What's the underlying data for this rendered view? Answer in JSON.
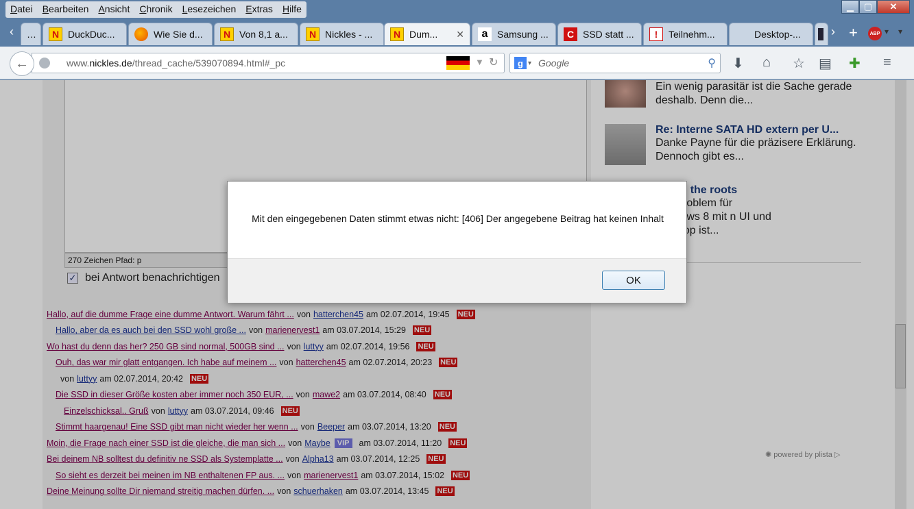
{
  "menu": [
    "Datei",
    "Bearbeiten",
    "Ansicht",
    "Chronik",
    "Lesezeichen",
    "Extras",
    "Hilfe"
  ],
  "window_controls": {
    "minimize": "▁",
    "maximize": "▢",
    "close": "✕"
  },
  "tabs": [
    {
      "label": "DuckDuc...",
      "icon": "N"
    },
    {
      "label": "Wie Sie d...",
      "icon": ""
    },
    {
      "label": "Von 8,1 a...",
      "icon": "N"
    },
    {
      "label": "Nickles - ...",
      "icon": "N"
    },
    {
      "label": "Dum...",
      "icon": "N",
      "close": "✕"
    },
    {
      "label": "Samsung ...",
      "icon": "a"
    },
    {
      "label": "SSD statt ...",
      "icon": "C"
    },
    {
      "label": "Teilnehm...",
      "icon": "!"
    },
    {
      "label": "Desktop-...",
      "icon": ""
    }
  ],
  "tabbar_controls": {
    "left": "‹",
    "right": "›",
    "new": "+",
    "abp": "ABP"
  },
  "url": {
    "prefix": "www.",
    "domain": "nickles.de",
    "path": "/thread_cache/539070894.html#_pc"
  },
  "search": {
    "placeholder": "Google",
    "engine_icon": "g"
  },
  "nav_icons": [
    "download-icon",
    "home-icon",
    "star-icon",
    "reading-list-icon",
    "puzzle-icon",
    "menu-icon"
  ],
  "editor": {
    "charinfo": "270 Zeichen Pfad: p",
    "notify_label": "bei Antwort benachrichtigen",
    "check": "✓"
  },
  "threads": [
    {
      "title": "Hallo, auf die dumme Frage eine dumme Antwort. Warum fährt ...",
      "by": "von",
      "user": "hatterchen45",
      "date": "am 02.07.2014, 19:45",
      "badge": "NEU",
      "indent": 0
    },
    {
      "title": "Hallo, aber da es auch bei den SSD wohl große ...",
      "by": "von",
      "user": "marienervest1",
      "date": "am 03.07.2014, 15:29",
      "badge": "NEU",
      "indent": 1,
      "current": true
    },
    {
      "title": "Wo hast du denn das her? 250 GB sind normal, 500GB sind ...",
      "by": "von",
      "user": "luttyy",
      "date": "am 02.07.2014, 19:56",
      "badge": "NEU",
      "indent": 0
    },
    {
      "title": "Ouh, das war mir glatt entgangen. Ich habe auf meinem ...",
      "by": "von",
      "user": "hatterchen45",
      "date": "am 02.07.2014, 20:23",
      "badge": "NEU",
      "indent": 1
    },
    {
      "title": "",
      "by": "von",
      "user": "luttyy",
      "date": "am 02.07.2014, 20:42",
      "badge": "NEU",
      "indent": 2
    },
    {
      "title": "Die SSD in dieser Größe kosten aber immer noch 350 EUR, ...",
      "by": "von",
      "user": "mawe2",
      "date": "am 03.07.2014, 08:40",
      "badge": "NEU",
      "indent": 1
    },
    {
      "title": "Einzelschicksal.. Gruß",
      "by": "von",
      "user": "luttyy",
      "date": "am 03.07.2014, 09:46",
      "badge": "NEU",
      "indent": 2
    },
    {
      "title": "Stimmt haargenau! Eine SSD gibt man nicht wieder her wenn ...",
      "by": "von",
      "user": "Beeper",
      "date": "am 03.07.2014, 13:20",
      "badge": "NEU",
      "indent": 1
    },
    {
      "title": "Moin, die Frage nach einer SSD ist die gleiche, die man sich ...",
      "by": "von",
      "user": "Maybe",
      "vip": "VIP",
      "date": "am 03.07.2014, 11:20",
      "badge": "NEU",
      "indent": 0
    },
    {
      "title": "Bei deinem NB solltest du definitiv ne SSD als Systemplatte ...",
      "by": "von",
      "user": "Alpha13",
      "date": "am 03.07.2014, 12:25",
      "badge": "NEU",
      "indent": 0
    },
    {
      "title": "So sieht es derzeit bei meinen im NB enthaltenen FP aus. ...",
      "by": "von",
      "user": "marienervest1",
      "date": "am 03.07.2014, 15:02",
      "badge": "NEU",
      "indent": 1
    },
    {
      "title": "Deine Meinung sollte Dir niemand streitig machen dürfen. ...",
      "by": "von",
      "user": "schuerhaken",
      "date": "am 03.07.2014, 13:45",
      "badge": "NEU",
      "indent": 0
    }
  ],
  "sidebar": [
    {
      "title": "",
      "text": "Ein wenig parasitär ist die Sache gerade deshalb. Denn die..."
    },
    {
      "title": "Re: Interne SATA HD extern per U...",
      "text": "Danke Payne für die präzisere Erklärung. Dennoch gibt es..."
    },
    {
      "title": "ack to the roots",
      "text": "auptproblem für Windows 8 mit n UI und Desktop ist..."
    }
  ],
  "plista": "powered by plista",
  "dialog": {
    "message": "Mit den eingegebenen Daten stimmt etwas nicht: [406] Der angegebene Beitrag hat keinen Inhalt",
    "ok": "OK"
  }
}
